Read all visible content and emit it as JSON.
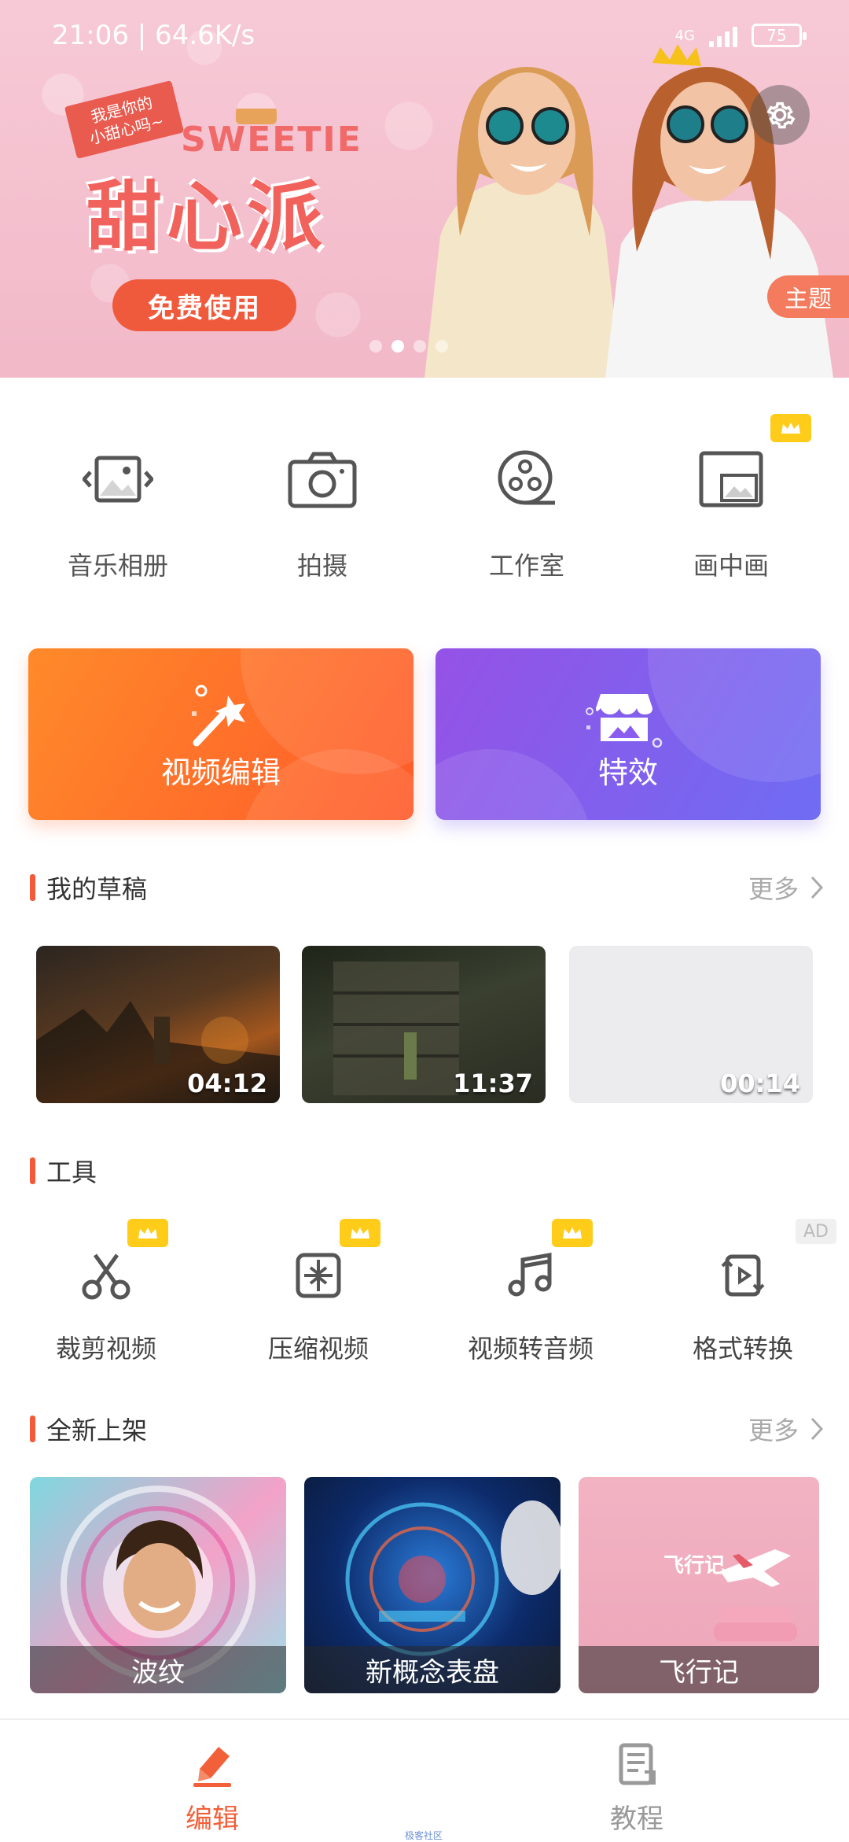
{
  "status_bar": {
    "time_speed": "21:06 | 64.6K/s",
    "network": "4G",
    "battery": "75"
  },
  "banner": {
    "tag_line1": "我是你的",
    "tag_line2": "小甜心吗~",
    "brand": "SWEETIE",
    "title": "甜心派",
    "cta": "免费使用",
    "theme_tab": "主题",
    "dot_count": 4,
    "active_dot": 1
  },
  "quick_actions": [
    {
      "label": "音乐相册",
      "icon": "photo-album-icon",
      "premium": false
    },
    {
      "label": "拍摄",
      "icon": "camera-icon",
      "premium": false
    },
    {
      "label": "工作室",
      "icon": "film-reel-icon",
      "premium": false
    },
    {
      "label": "画中画",
      "icon": "picture-in-picture-icon",
      "premium": true
    }
  ],
  "cards": {
    "edit": {
      "label": "视频编辑",
      "icon": "magic-wand-icon"
    },
    "effects": {
      "label": "特效",
      "icon": "store-icon"
    }
  },
  "drafts": {
    "title": "我的草稿",
    "more": "更多",
    "items": [
      {
        "duration": "04:12"
      },
      {
        "duration": "11:37"
      },
      {
        "duration": "00:14"
      }
    ]
  },
  "tools": {
    "title": "工具",
    "items": [
      {
        "label": "裁剪视频",
        "icon": "scissors-icon",
        "badge": "crown"
      },
      {
        "label": "压缩视频",
        "icon": "compress-icon",
        "badge": "crown"
      },
      {
        "label": "视频转音频",
        "icon": "music-note-icon",
        "badge": "crown"
      },
      {
        "label": "格式转换",
        "icon": "convert-icon",
        "badge": "AD"
      }
    ]
  },
  "new_arrivals": {
    "title": "全新上架",
    "more": "更多",
    "items": [
      {
        "caption": "波纹"
      },
      {
        "caption": "新概念表盘"
      },
      {
        "caption": "飞行记",
        "overlay_text": "飞行记"
      }
    ]
  },
  "bottom_nav": {
    "tabs": [
      {
        "label": "编辑",
        "icon": "edit-pencil-icon",
        "active": true
      },
      {
        "label": "教程",
        "icon": "tutorial-doc-icon",
        "active": false
      }
    ],
    "watermark": "极客社区"
  },
  "colors": {
    "accent": "#f2603a",
    "edit_card": "#ff6a2a",
    "effects_card": "#7f5ff0",
    "premium_badge": "#ffcc1a"
  }
}
